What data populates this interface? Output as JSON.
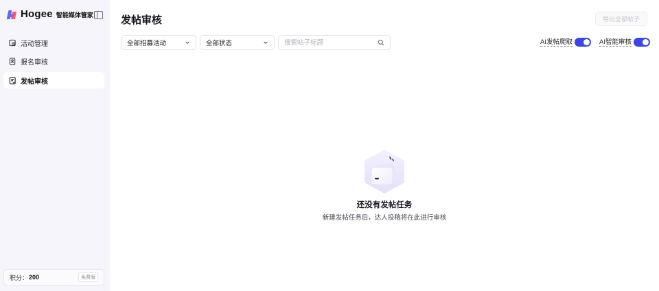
{
  "brand": {
    "name": "Hogee",
    "subtitle": "智能媒体管家"
  },
  "sidebar": {
    "items": [
      {
        "label": "活动管理",
        "icon": "activity-icon",
        "active": false
      },
      {
        "label": "报名审核",
        "icon": "signup-review-icon",
        "active": false
      },
      {
        "label": "发帖审核",
        "icon": "post-review-icon",
        "active": true
      }
    ],
    "points": {
      "label": "积分：",
      "value": "200",
      "plan": "免费版"
    }
  },
  "main": {
    "title": "发帖审核",
    "export_label": "导出全部帖子",
    "filters": {
      "campaign_select": "全部招募活动",
      "status_select": "全部状态",
      "search_placeholder": "搜索帖子标题"
    },
    "toggles": [
      {
        "label": "AI发帖爬取",
        "on": true
      },
      {
        "label": "AI智能审核",
        "on": true
      }
    ],
    "empty_state": {
      "title": "还没有发帖任务",
      "description": "新建发帖任务后，达人投稿将在此进行审核"
    }
  },
  "colors": {
    "accent": "#3b45e8",
    "sidebar_bg": "#f5f5fb"
  }
}
